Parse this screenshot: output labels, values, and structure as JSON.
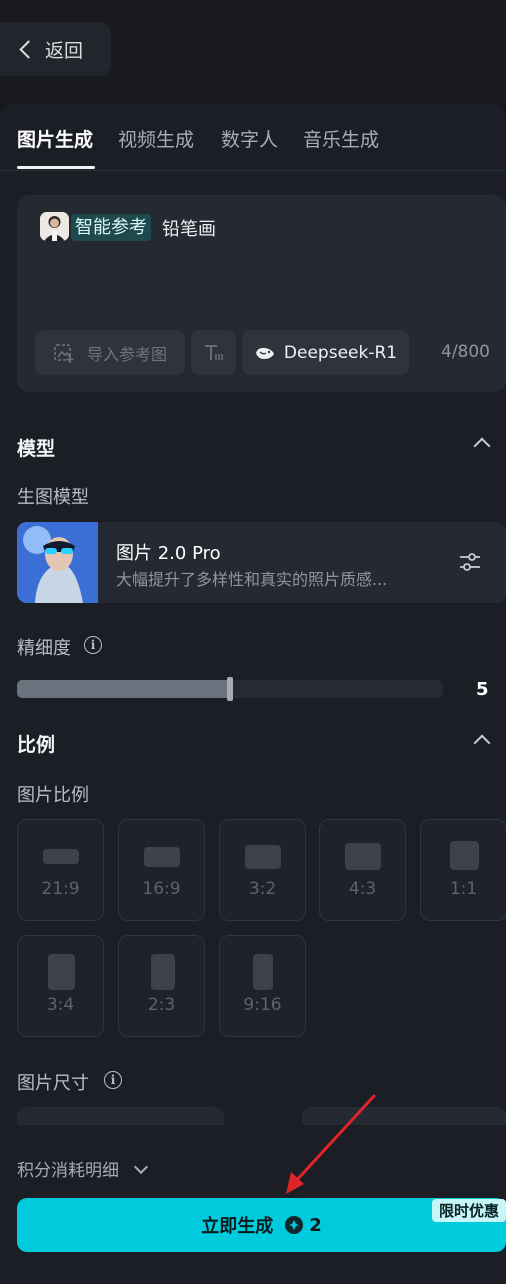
{
  "header": {
    "back_label": "返回"
  },
  "tabs": [
    {
      "label": "图片生成",
      "active": true
    },
    {
      "label": "视频生成"
    },
    {
      "label": "数字人"
    },
    {
      "label": "音乐生成"
    }
  ],
  "prompt": {
    "ref_tag": "智能参考",
    "text": "铅笔画",
    "import_ref_label": "导入参考图",
    "model_chip": "Deepseek-R1",
    "counter": "4/800"
  },
  "model_section": {
    "title": "模型",
    "sub_label": "生图模型",
    "model_name": "图片 2.0 Pro",
    "model_desc": "大幅提升了多样性和真实的照片质感..."
  },
  "detail": {
    "label": "精细度",
    "value": "5",
    "level_fraction": 0.5
  },
  "ratio_section": {
    "title": "比例",
    "sub_label": "图片比例",
    "options": [
      "21:9",
      "16:9",
      "3:2",
      "4:3",
      "1:1",
      "3:4",
      "2:3",
      "9:16"
    ]
  },
  "size": {
    "label": "图片尺寸"
  },
  "footer": {
    "points_detail": "积分消耗明细",
    "generate_label": "立即生成",
    "cost": "2",
    "promo": "限时优惠"
  },
  "colors": {
    "accent": "#00cbdc",
    "arrow": "#e0242a"
  }
}
